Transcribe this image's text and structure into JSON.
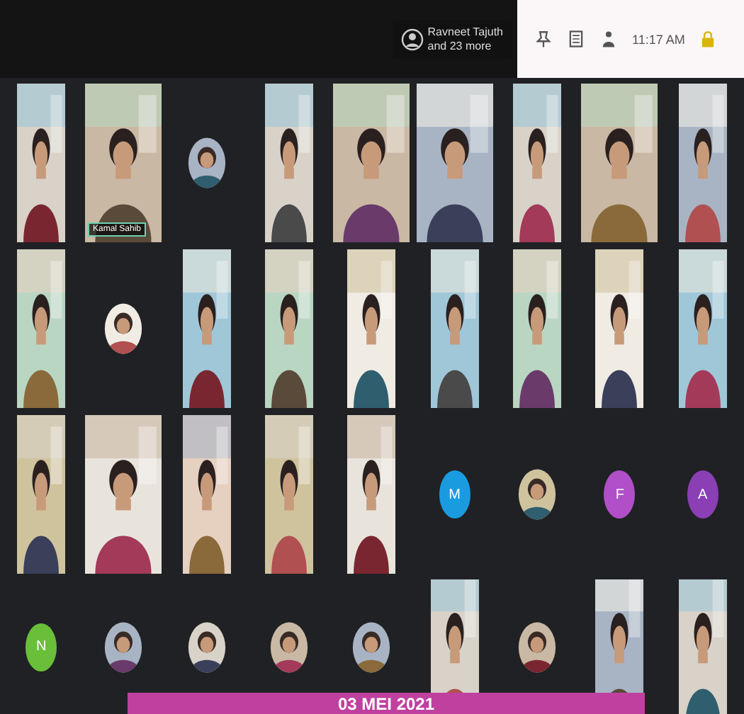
{
  "top_bar": {
    "presenter": {
      "name": "Ravneet Tajuth",
      "more": "and 23 more"
    },
    "time": "11:17 AM"
  },
  "grid": {
    "rows": [
      [
        {
          "kind": "video"
        },
        {
          "kind": "video_wide",
          "name": "Kamal Sahib"
        },
        {
          "kind": "avatar_photo"
        },
        {
          "kind": "video"
        },
        {
          "kind": "video_wide"
        },
        {
          "kind": "video_wide"
        },
        {
          "kind": "video"
        },
        {
          "kind": "video_wide"
        },
        {
          "kind": "video"
        }
      ],
      [
        {
          "kind": "video"
        },
        {
          "kind": "avatar_photo"
        },
        {
          "kind": "video"
        },
        {
          "kind": "video"
        },
        {
          "kind": "video"
        },
        {
          "kind": "video"
        },
        {
          "kind": "video"
        },
        {
          "kind": "video"
        },
        {
          "kind": "video"
        }
      ],
      [
        {
          "kind": "video"
        },
        {
          "kind": "video_wide"
        },
        {
          "kind": "video"
        },
        {
          "kind": "video"
        },
        {
          "kind": "video"
        },
        {
          "kind": "avatar",
          "letter": "M",
          "color": "#1a9be0"
        },
        {
          "kind": "avatar_photo"
        },
        {
          "kind": "avatar",
          "letter": "F",
          "color": "#b04fc8"
        },
        {
          "kind": "avatar",
          "letter": "A",
          "color": "#8a3fb5"
        }
      ],
      [
        {
          "kind": "avatar",
          "letter": "N",
          "color": "#6abf3a"
        },
        {
          "kind": "avatar_photo"
        },
        {
          "kind": "avatar_photo"
        },
        {
          "kind": "avatar_photo"
        },
        {
          "kind": "avatar_photo"
        },
        {
          "kind": "video"
        },
        {
          "kind": "avatar_photo"
        },
        {
          "kind": "video"
        },
        {
          "kind": "video"
        }
      ]
    ]
  },
  "banner": {
    "text": "03 MEI 2021"
  }
}
